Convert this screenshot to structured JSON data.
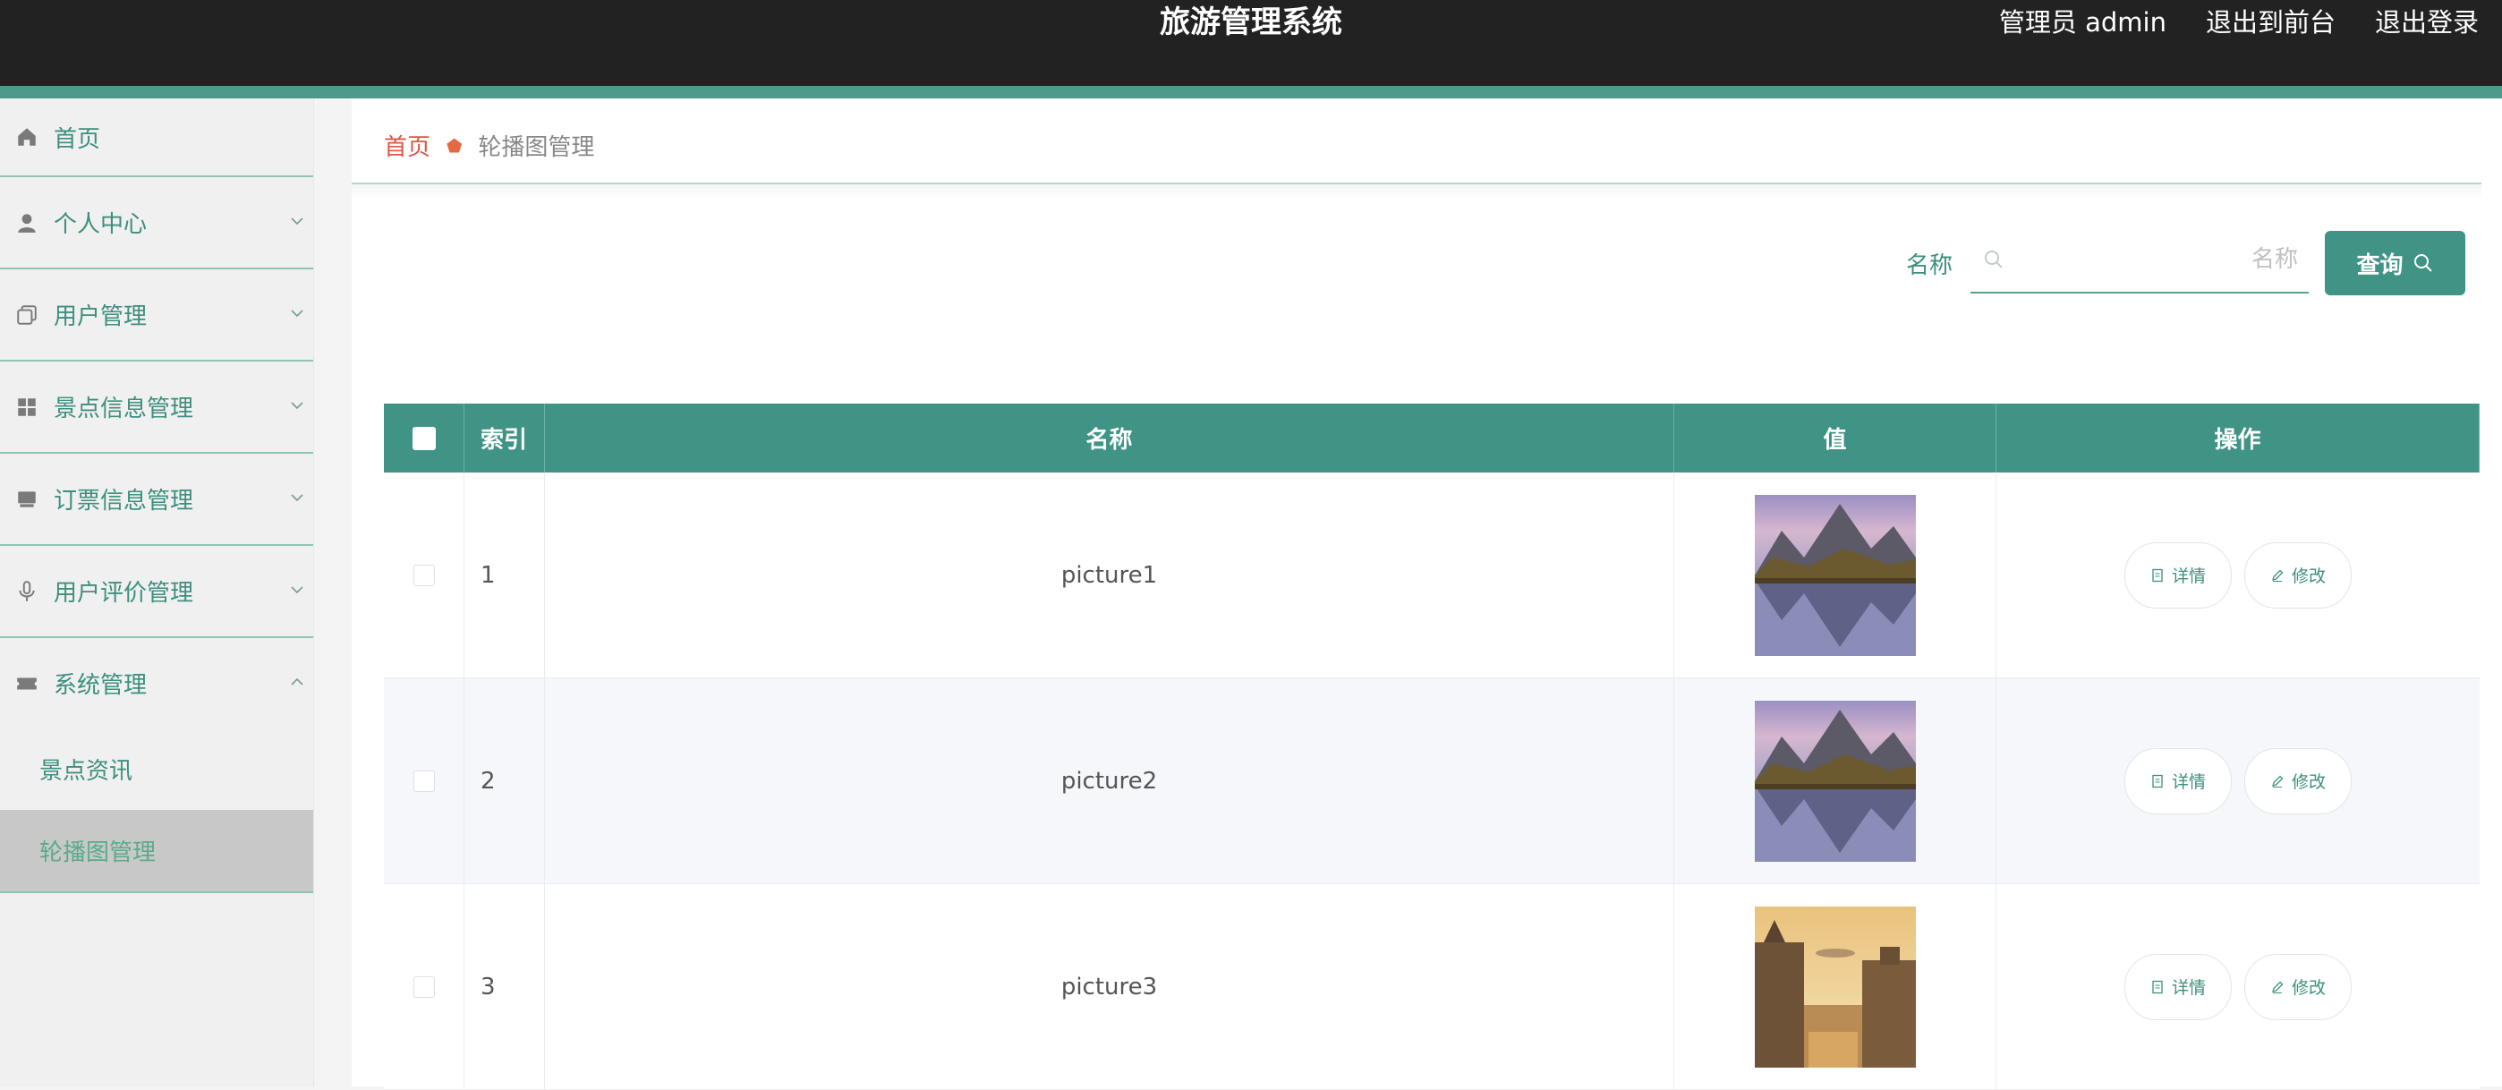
{
  "header": {
    "title": "旅游管理系统",
    "admin_label": "管理员 admin",
    "to_front": "退出到前台",
    "logout": "退出登录"
  },
  "sidebar": {
    "items": [
      {
        "label": "首页",
        "icon": "home-icon"
      },
      {
        "label": "个人中心",
        "icon": "user-icon"
      },
      {
        "label": "用户管理",
        "icon": "copy-icon"
      },
      {
        "label": "景点信息管理",
        "icon": "grid-icon"
      },
      {
        "label": "订票信息管理",
        "icon": "monitor-icon"
      },
      {
        "label": "用户评价管理",
        "icon": "microphone-icon"
      },
      {
        "label": "系统管理",
        "icon": "ticket-icon"
      }
    ],
    "sub_items": [
      {
        "label": "景点资讯"
      },
      {
        "label": "轮播图管理",
        "active": true
      }
    ]
  },
  "breadcrumb": {
    "home": "首页",
    "current": "轮播图管理"
  },
  "search": {
    "label": "名称",
    "placeholder": "名称",
    "button": "查询"
  },
  "table": {
    "headers": {
      "index": "索引",
      "name": "名称",
      "value": "值",
      "actions": "操作"
    },
    "rows": [
      {
        "index": "1",
        "name": "picture1",
        "image": "mountain-lake"
      },
      {
        "index": "2",
        "name": "picture2",
        "image": "mountain-lake"
      },
      {
        "index": "3",
        "name": "picture3",
        "image": "canal-town"
      }
    ],
    "detail_label": "详情",
    "edit_label": "修改"
  },
  "colors": {
    "accent": "#3f9485",
    "header_bg": "#222222",
    "breadcrumb_home": "#e05545"
  }
}
